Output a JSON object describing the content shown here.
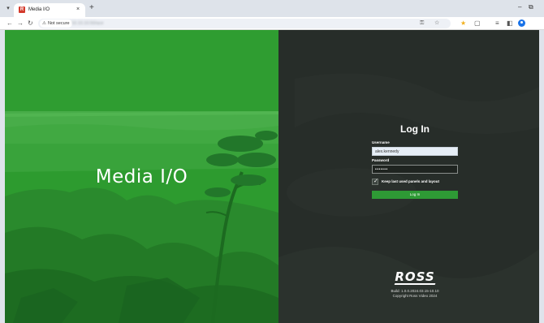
{
  "browser": {
    "tab": {
      "title": "Media I/O",
      "favicon": "ross-media-io-favicon",
      "close": "×"
    },
    "new_tab": "+",
    "tab_list": "▾",
    "window": {
      "minimize": "–",
      "maximize": "⧉"
    },
    "nav": {
      "back": "←",
      "forward": "→",
      "reload": "↻"
    },
    "security_chip": {
      "icon": "⚠",
      "label": "Not secure"
    },
    "url": "10.10.10.50/ace",
    "omnibox_icons": {
      "password_key": "⚿",
      "bookmark": "☆"
    },
    "toolbar_icons": {
      "extension_highlight": "★",
      "extensions": "▢",
      "playlist": "≡",
      "sidepanel": "◧"
    }
  },
  "left": {
    "brand": "Media I/O",
    "colors": {
      "overlay": "#2d9b2f",
      "sea": "#4bb04c",
      "rocks": "#1f6e23"
    }
  },
  "login": {
    "title": "Log In",
    "username_label": "Username",
    "username_value": "alex.kennedy",
    "password_label": "Password",
    "password_value": "•••••••",
    "keep_checked": true,
    "keep_label": "Keep last used panels and layout",
    "button": "Log In",
    "colors": {
      "button": "#2e9a35",
      "background": "#272d29"
    }
  },
  "footer": {
    "logo": "ROSS",
    "build": "Build: 1.0.0.2024.03.15-10.10",
    "copyright": "Copyright Ross Video 2024"
  }
}
